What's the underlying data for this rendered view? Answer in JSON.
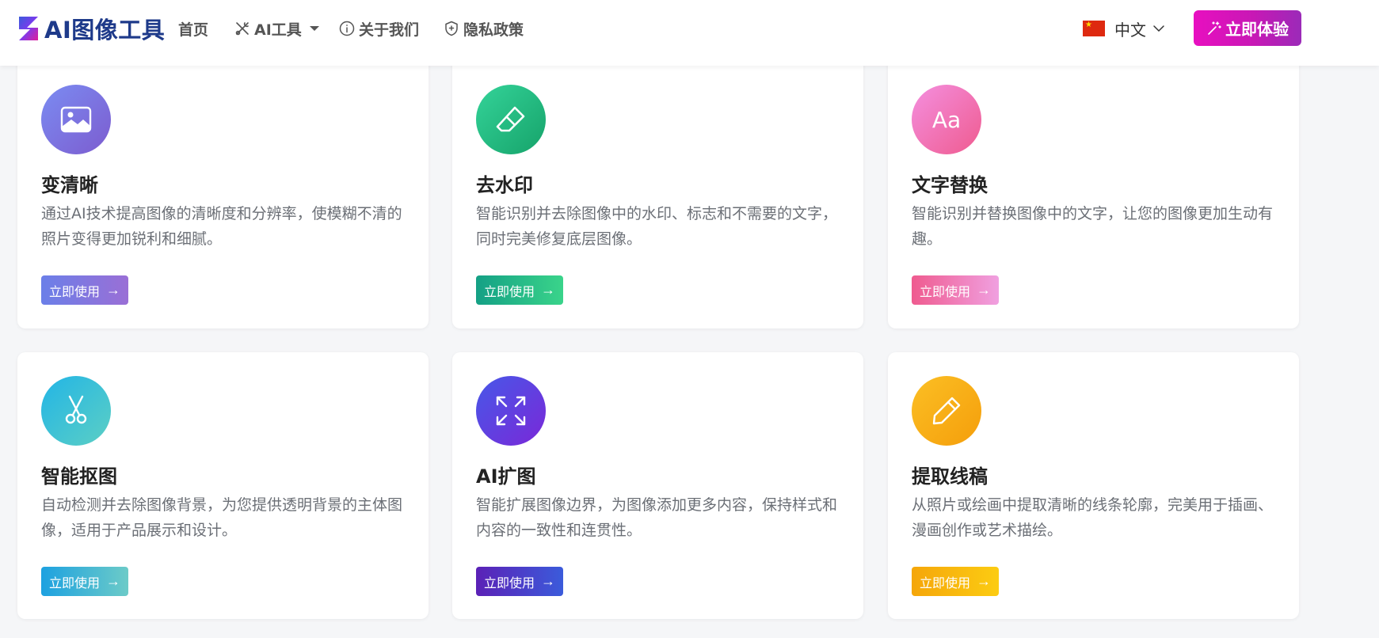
{
  "header": {
    "brand": "AI图像工具",
    "nav": [
      {
        "label": "首页"
      },
      {
        "label": "AI工具"
      },
      {
        "label": "关于我们"
      },
      {
        "label": "隐私政策"
      }
    ],
    "language": "中文",
    "cta_label": "立即体验"
  },
  "cards": [
    {
      "title": "变清晰",
      "desc": "通过AI技术提高图像的清晰度和分辨率，使模糊不清的照片变得更加锐利和细腻。",
      "button": "立即使用",
      "icon": "image-icon"
    },
    {
      "title": "去水印",
      "desc": "智能识别并去除图像中的水印、标志和不需要的文字，同时完美修复底层图像。",
      "button": "立即使用",
      "icon": "eraser-icon"
    },
    {
      "title": "文字替换",
      "desc": "智能识别并替换图像中的文字，让您的图像更加生动有趣。",
      "button": "立即使用",
      "icon": "text-aa-icon",
      "icon_text": "Aa"
    },
    {
      "title": "智能抠图",
      "desc": "自动检测并去除图像背景，为您提供透明背景的主体图像，适用于产品展示和设计。",
      "button": "立即使用",
      "icon": "scissors-icon"
    },
    {
      "title": "AI扩图",
      "desc": "智能扩展图像边界，为图像添加更多内容，保持样式和内容的一致性和连贯性。",
      "button": "立即使用",
      "icon": "expand-icon"
    },
    {
      "title": "提取线稿",
      "desc": "从照片或绘画中提取清晰的线条轮廓，完美用于插画、漫画创作或艺术描绘。",
      "button": "立即使用",
      "icon": "pencil-icon"
    }
  ],
  "colors": {
    "brand_text": "#1e3a8a",
    "cta_gradient_start": "#e80fc0",
    "cta_gradient_end": "#9b2ab8"
  }
}
